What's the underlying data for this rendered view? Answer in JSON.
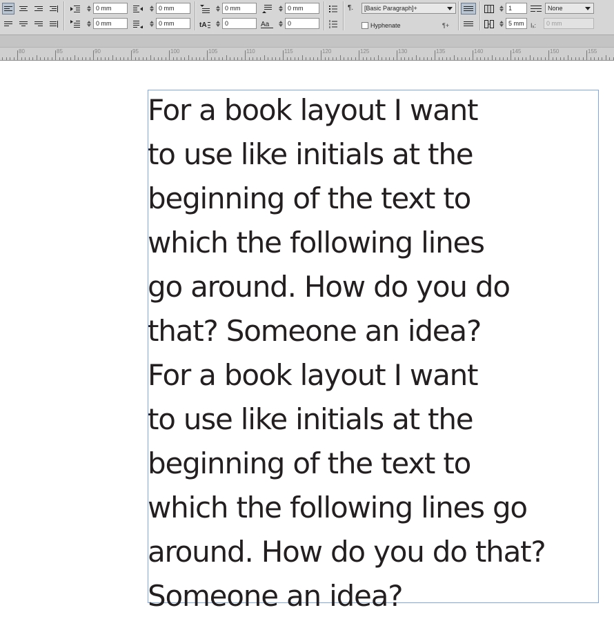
{
  "control_panel": {
    "left_indent": "0 mm",
    "right_indent": "0 mm",
    "first_line_indent": "0 mm",
    "last_line_indent": "0 mm",
    "space_before": "0 mm",
    "space_after": "0 mm",
    "dropcap_lines": "0",
    "dropcap_chars": "0",
    "paragraph_style": "[Basic Paragraph]+",
    "hyphenate_label": "Hyphenate",
    "hyphenate_checked": false,
    "columns": "1",
    "span_columns": "None",
    "gutter": "5 mm",
    "column_width": "0 mm"
  },
  "ruler": {
    "labels": [
      "80",
      "85",
      "90",
      "95",
      "100",
      "105",
      "110",
      "115",
      "120",
      "125",
      "130",
      "135",
      "140",
      "145",
      "150",
      "155"
    ]
  },
  "document": {
    "story_lines": [
      "For a book layout I want",
      "to use like initials at the",
      "beginning of the text to",
      "which the following lines",
      "go around. How do you do",
      "that? Someone an idea?",
      "For a book layout I want",
      "to use like initials at the",
      "beginning of the text to",
      "which the following lines go",
      "around. How do you do that?",
      "Someone an idea?"
    ]
  },
  "colors": {
    "frame_border": "#7fa5e6",
    "text": "#231f20",
    "panel_bg": "#d6d6d6"
  }
}
